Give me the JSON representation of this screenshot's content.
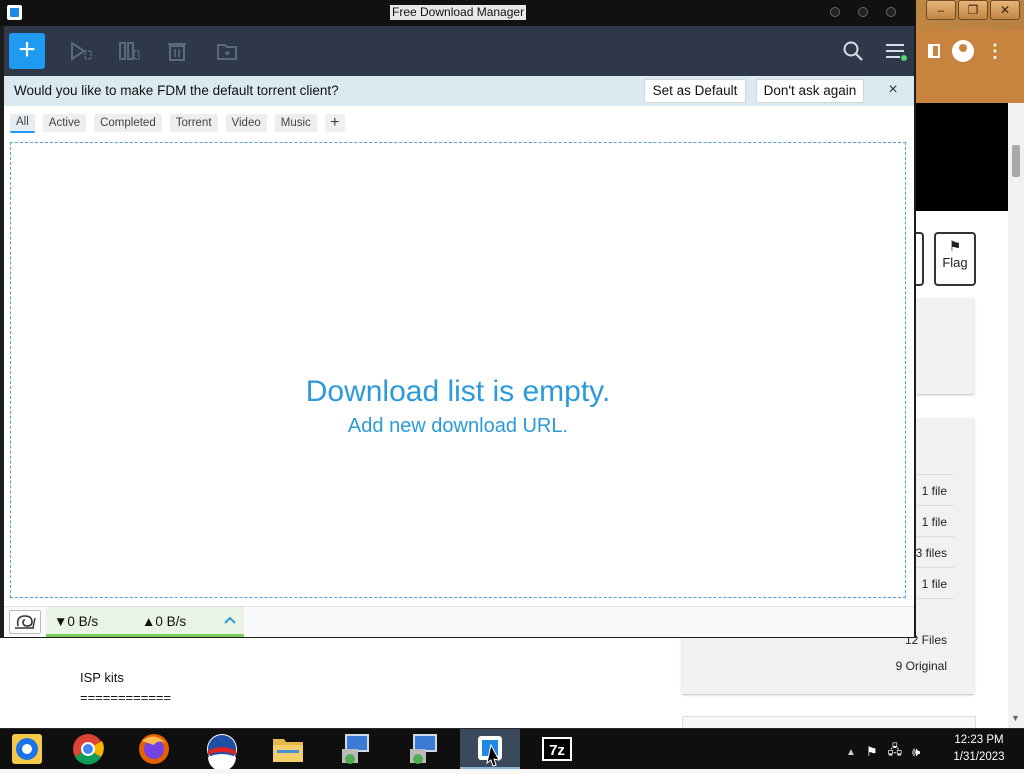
{
  "window": {
    "title": "Free Download Manager"
  },
  "notice": {
    "text": "Would you like to make FDM the default torrent client?",
    "set_default_label": "Set as Default",
    "dont_ask_label": "Don't ask again",
    "close_label": "×"
  },
  "tabs": [
    {
      "label": "All",
      "active": true
    },
    {
      "label": "Active",
      "active": false
    },
    {
      "label": "Completed",
      "active": false
    },
    {
      "label": "Torrent",
      "active": false
    },
    {
      "label": "Video",
      "active": false
    },
    {
      "label": "Music",
      "active": false
    }
  ],
  "tab_add_label": "+",
  "empty": {
    "title": "Download list is empty.",
    "subtitle": "Add new download URL."
  },
  "status": {
    "download_speed": "▼0 B/s",
    "upload_speed": "▲0 B/s"
  },
  "toolbar": {
    "add_label": "+",
    "icons": [
      "add-icon",
      "resume-icon",
      "pause-icon",
      "delete-icon",
      "move-folder-icon",
      "search-icon",
      "menu-icon"
    ]
  },
  "background": {
    "flag_label": "Flag",
    "file_counts": [
      "1 file",
      "1 file",
      "3 files",
      "1 file"
    ],
    "files_total": "12 Files",
    "files_original": "9 Original",
    "isp_text": "ISP kits",
    "rule_text": "============"
  },
  "taskbar": {
    "apps": [
      "chrome-dev",
      "chrome",
      "firefox",
      "obama-app",
      "file-explorer",
      "installer-1",
      "installer-2",
      "free-download-manager",
      "7zip"
    ],
    "active_app": "free-download-manager",
    "clock_time": "12:23 PM",
    "clock_date": "1/31/2023"
  },
  "colors": {
    "accent": "#2b9ada",
    "add_button": "#1e9af0",
    "toolbar_bg": "#2f3849",
    "notice_bg": "#dbe9f1",
    "speed_bar": "#7ccd5e"
  }
}
